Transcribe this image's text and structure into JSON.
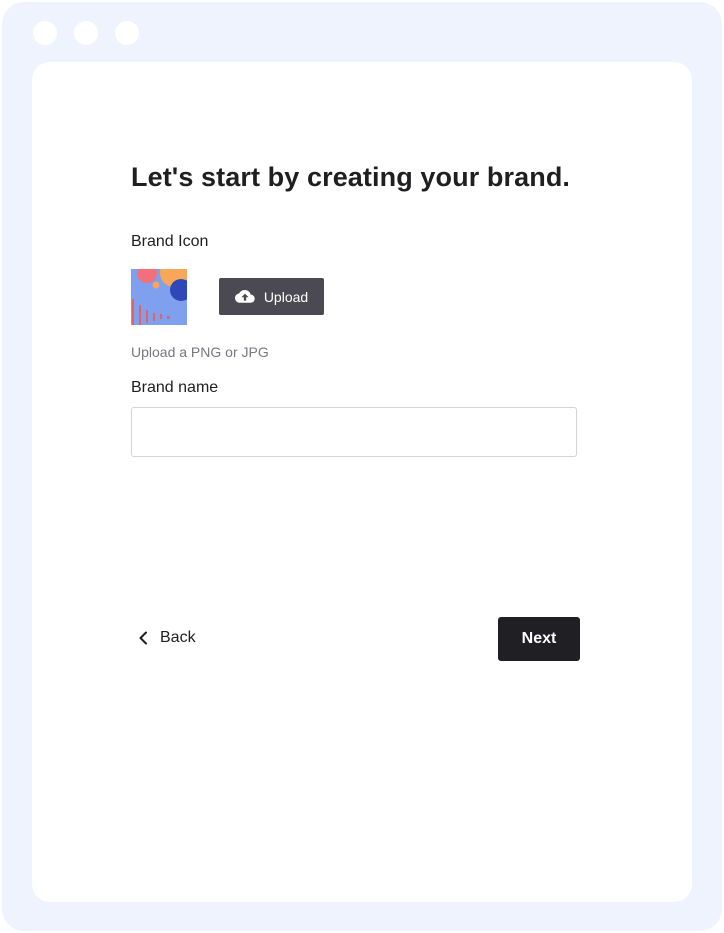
{
  "window": {
    "controls": [
      "dot",
      "dot",
      "dot"
    ]
  },
  "form": {
    "title": "Let's start by creating your brand.",
    "brand_icon_label": "Brand Icon",
    "upload_label": "Upload",
    "upload_hint": "Upload a PNG or JPG",
    "brand_name_label": "Brand name",
    "brand_name_value": "",
    "brand_name_placeholder": ""
  },
  "nav": {
    "back_label": "Back",
    "next_label": "Next"
  },
  "icons": {
    "upload": "cloud-upload-icon",
    "back": "chevron-left-icon",
    "brand": "brand-image-thumbnail"
  },
  "colors": {
    "frame_background": "#eef3fd",
    "card_background": "#ffffff",
    "primary_dark": "#201f23",
    "upload_button": "#4b4a52",
    "hint_text": "#7a7680",
    "input_border": "#d3d3d8"
  }
}
